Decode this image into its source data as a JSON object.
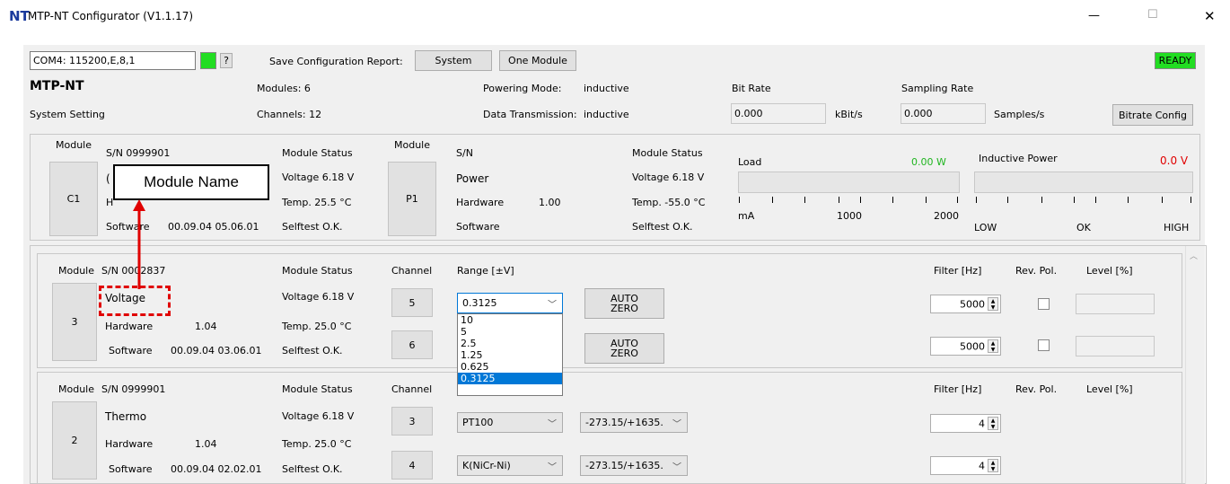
{
  "window": {
    "title": "MTP-NT Configurator (V1.1.17)",
    "logo": "NT",
    "controls": {
      "minimize": "—",
      "maximize": "☐",
      "close": "✕"
    }
  },
  "toolbar": {
    "port": "COM4: 115200,E,8,1",
    "help": "?",
    "save_label": "Save Configuration Report:",
    "system_btn": "System",
    "one_module_btn": "One Module",
    "status": "READY",
    "status_color": "#22dd22"
  },
  "system": {
    "name": "MTP-NT",
    "setting": "System Setting",
    "modules": "Modules: 6",
    "channels": "Channels: 12",
    "powering_label": "Powering Mode:",
    "powering_value": "inductive",
    "transmission_label": "Data Transmission:",
    "transmission_value": "inductive",
    "bitrate_label": "Bit Rate",
    "bitrate_value": "0.000",
    "bitrate_unit": "kBit/s",
    "sampling_label": "Sampling Rate",
    "sampling_value": "0.000",
    "sampling_unit": "Samples/s",
    "bitrate_config": "Bitrate Config"
  },
  "c1": {
    "module_label": "Module",
    "button": "C1",
    "sn": "S/N 0999901",
    "hidden_name_fragment": "(",
    "hidden_hw_fragment": "H",
    "software_label": "Software",
    "software_value": "00.09.04  05.06.01",
    "status_label": "Module Status",
    "voltage": "Voltage  6.18 V",
    "temp": "Temp.   25.5 °C",
    "selftest": "Selftest  O.K."
  },
  "p1": {
    "module_label": "Module",
    "button": "P1",
    "sn": "S/N",
    "name": "Power",
    "hardware_label": "Hardware",
    "hardware_value": "1.00",
    "software_label": "Software",
    "status_label": "Module Status",
    "voltage": "Voltage  6.18 V",
    "temp": "Temp.   -55.0 °C",
    "selftest": "Selftest  O.K.",
    "load_label": "Load",
    "load_value": "0.00 W",
    "load_value_color": "#1fb51f",
    "load_unit": "mA",
    "load_mid": "1000",
    "load_max": "2000",
    "ind_label": "Inductive Power",
    "ind_value": "0.0  V",
    "ind_value_color": "#e00000",
    "ind_low": "LOW",
    "ind_ok": "OK",
    "ind_high": "HIGH"
  },
  "mod3": {
    "module_label": "Module",
    "button": "3",
    "sn": "S/N 0002837",
    "name": "Voltage",
    "hardware_label": "Hardware",
    "hardware_value": "1.04",
    "software_label": "Software",
    "software_value": "00.09.04  03.06.01",
    "status_label": "Module Status",
    "voltage": "Voltage  6.18 V",
    "temp": "Temp.   25.0 °C",
    "selftest": "Selftest  O.K.",
    "channel_label": "Channel",
    "range_label": "Range  [±V]",
    "ch1": "5",
    "ch2": "6",
    "range_value": "0.3125",
    "auto_zero_1a": "AUTO",
    "auto_zero_1b": "ZERO",
    "auto_zero_2a": "AUTO",
    "auto_zero_2b": "ZERO",
    "filter_label": "Filter [Hz]",
    "revpol_label": "Rev. Pol.",
    "level_label": "Level  [%]",
    "filter1": "5000",
    "filter2": "5000"
  },
  "range_dropdown": {
    "options": [
      "10",
      "5",
      "2.5",
      "1.25",
      "0.625",
      "0.3125"
    ],
    "selected_index": 5,
    "highlight_color": "#0078d7"
  },
  "annotation": {
    "callout": "Module Name",
    "color": "#e00000"
  },
  "mod2": {
    "module_label": "Module",
    "button": "2",
    "sn": "S/N 0999901",
    "name": "Thermo",
    "hardware_label": "Hardware",
    "hardware_value": "1.04",
    "software_label": "Software",
    "software_value": "00.09.04  02.02.01",
    "status_label": "Module Status",
    "voltage": "Voltage  6.18 V",
    "temp": "Temp.   25.0 °C",
    "selftest": "Selftest  O.K.",
    "channel_label": "Channel",
    "ch1": "3",
    "ch2": "4",
    "sensor1": "PT100",
    "sensor2": "K(NiCr-Ni)",
    "range1": "-273.15/+1635.",
    "range2": "-273.15/+1635.",
    "filter_label": "Filter [Hz]",
    "revpol_label": "Rev. Pol.",
    "level_label": "Level  [%]",
    "filter1": "4",
    "filter2": "4"
  }
}
